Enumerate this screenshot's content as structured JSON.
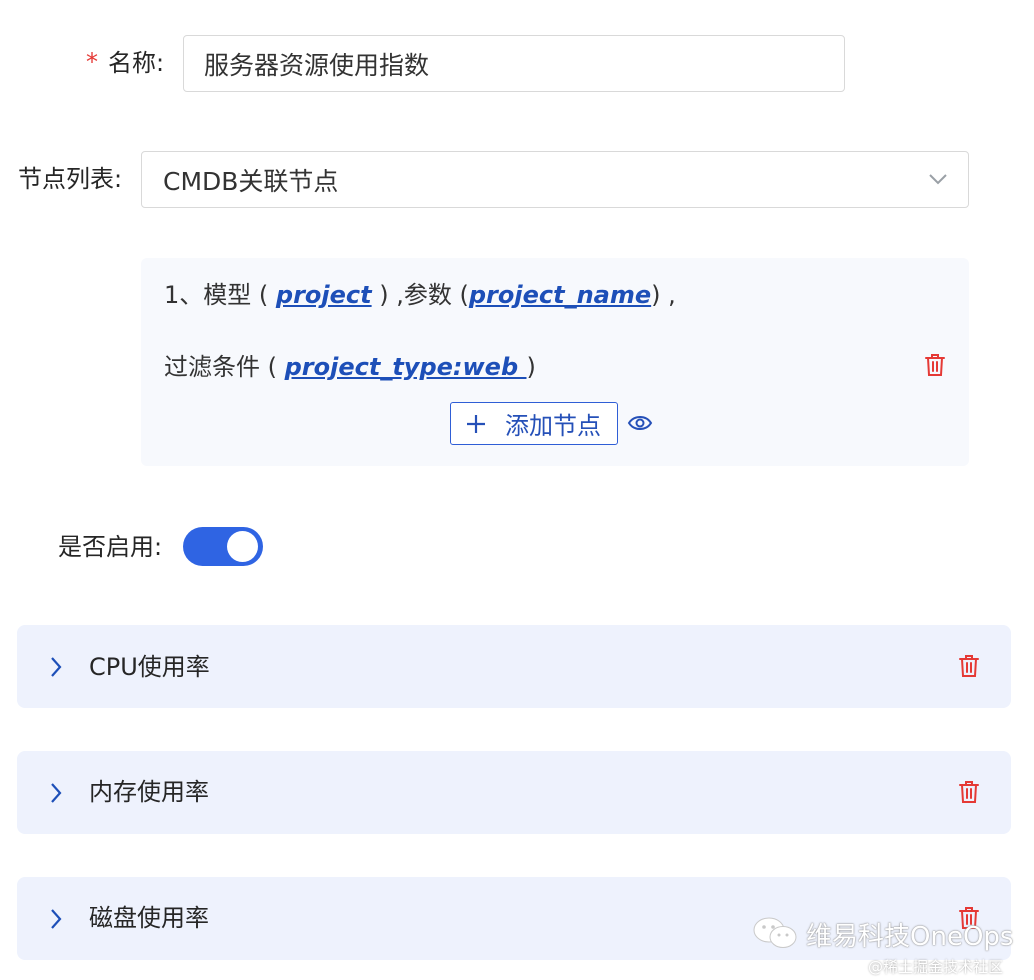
{
  "form": {
    "name": {
      "required_mark": "*",
      "label": "名称:",
      "value": "服务器资源使用指数"
    },
    "nodes": {
      "label": "节点列表:",
      "selected": "CMDB关联节点",
      "chevron_icon": "chevron-down-icon"
    },
    "node_config": {
      "line1_prefix": "1、模型 ( ",
      "model": "project",
      "line1_mid": " ) ,参数 (",
      "param": "project_name",
      "line1_suffix": ") ,",
      "line2_prefix": "过滤条件 ( ",
      "filter": "project_type:web ",
      "line2_suffix": ")",
      "delete_icon": "trash-icon",
      "add_button_icon": "plus-icon",
      "add_button_label": "添加节点",
      "preview_icon": "eye-icon"
    },
    "enabled": {
      "label": "是否启用:",
      "value": true
    }
  },
  "metrics": [
    {
      "title": "CPU使用率"
    },
    {
      "title": "内存使用率"
    },
    {
      "title": "磁盘使用率"
    }
  ],
  "watermark": {
    "brand": "维易科技OneOps",
    "site": "@稀土掘金技术社区"
  },
  "colors": {
    "primary": "#2f64e3",
    "link": "#1d4fb8",
    "danger": "#e53935",
    "card_bg": "#eef2fd"
  }
}
